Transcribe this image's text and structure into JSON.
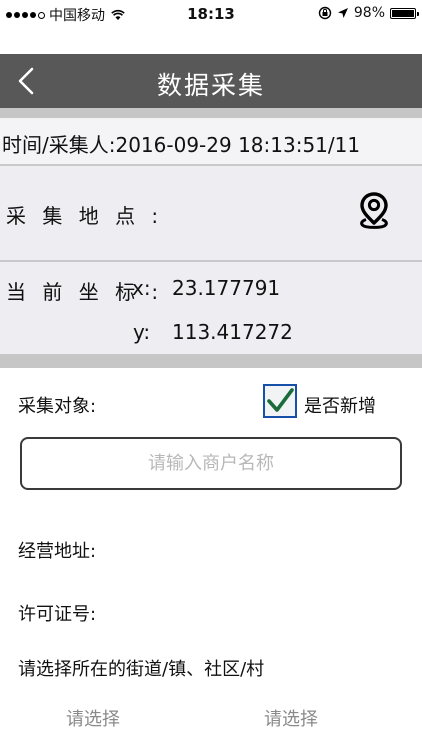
{
  "status_bar": {
    "carrier": "中国移动",
    "time": "18:13",
    "battery": "98%",
    "battery_level": 0.98
  },
  "nav": {
    "title": "数据采集",
    "back_icon": "chevron-left-icon"
  },
  "form": {
    "time_collector_text": "时间/采集人:2016-09-29  18:13:51/11",
    "location_label": "采 集 地 点 :",
    "location_icon": "map-pin-icon",
    "coord_label": "当 前 坐 标 :",
    "x_label": "x:",
    "x_value": "23.177791",
    "y_label": "y:",
    "y_value": "113.417272",
    "target_label": "采集对象:",
    "new_checkbox_checked": true,
    "new_checkbox_label": "是否新增",
    "merchant_placeholder": "请输入商户名称",
    "address_label": "经营地址:",
    "license_label": "许可证号:",
    "region_label": "请选择所在的街道/镇、社区/村",
    "select_left": "请选择",
    "select_right": "请选择"
  },
  "colors": {
    "nav_bg": "#585858",
    "checkbox_border": "#1750a8",
    "checkmark": "#1a6d3a"
  }
}
